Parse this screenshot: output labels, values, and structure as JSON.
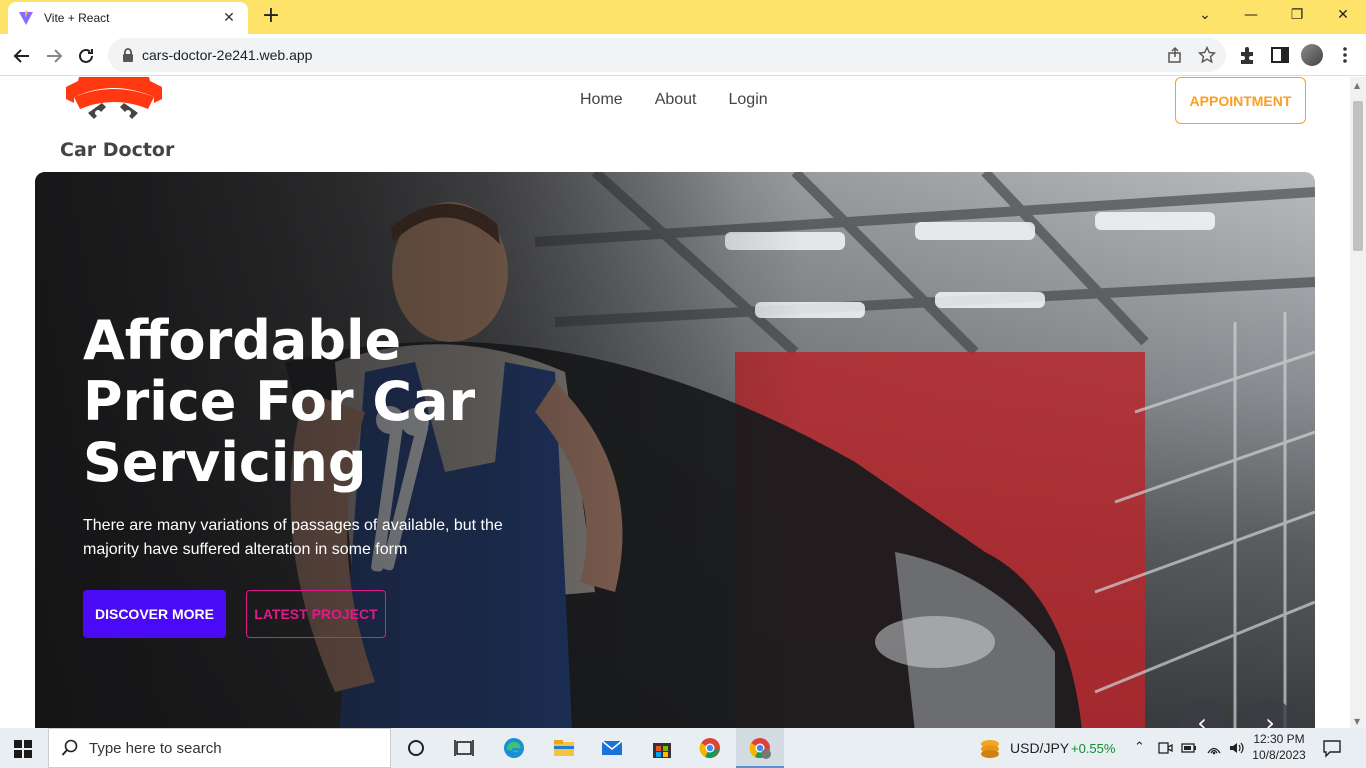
{
  "browser": {
    "tab_title": "Vite + React",
    "tab_close": "✕",
    "new_tab": "+",
    "url": "cars-doctor-2e241.web.app",
    "window_controls": {
      "chevron": "⌄",
      "minimize": "—",
      "restore": "❐",
      "close": "✕"
    }
  },
  "site": {
    "brand": "Car Doctor",
    "nav": [
      "Home",
      "About",
      "Login"
    ],
    "appointment_button": "APPOINTMENT",
    "colors": {
      "accent": "#ff9d1c",
      "primary_button": "#4a0af5",
      "secondary_button": "#e01a8a",
      "logo_red": "#ff3811"
    }
  },
  "hero": {
    "title_lines": [
      "Affordable",
      "Price For Car",
      "Servicing"
    ],
    "text": "There are many variations of passages of available, but the majority have suffered alteration in some form",
    "discover_button": "DISCOVER MORE",
    "latest_button": "LATEST PROJECT",
    "prev_arrow": "‹",
    "next_arrow": "›"
  },
  "taskbar": {
    "search_placeholder": "Type here to search",
    "ticker_symbol": "USD/JPY",
    "ticker_change": "+0.55%",
    "time": "12:30 PM",
    "date": "10/8/2023"
  }
}
